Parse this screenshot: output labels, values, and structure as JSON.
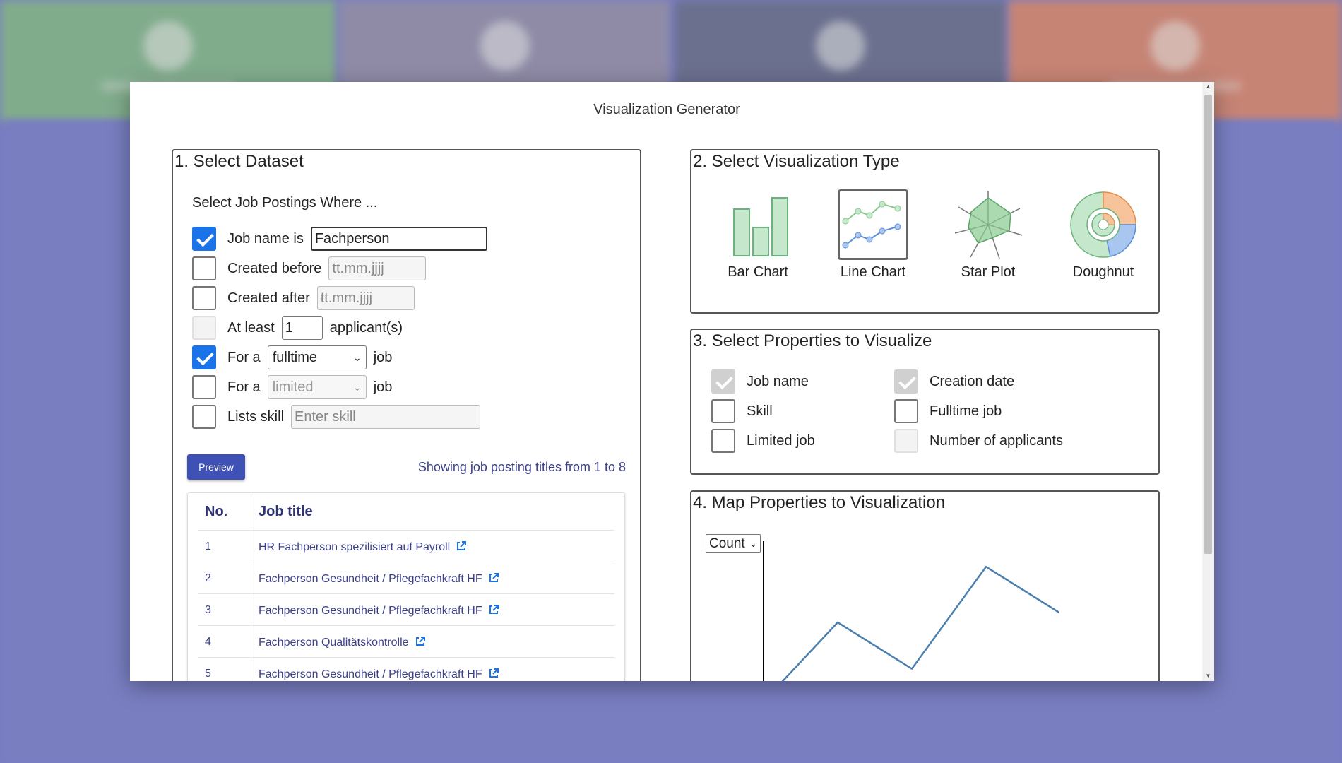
{
  "modal": {
    "title": "Visualization Generator"
  },
  "dataset": {
    "section_title": "1. Select Dataset",
    "intro": "Select Job Postings Where ...",
    "job_name": {
      "label": "Job name is",
      "value": "Fachperson",
      "checked": true
    },
    "created_before": {
      "label": "Created before",
      "placeholder": "tt.mm.jjjj",
      "checked": false
    },
    "created_after": {
      "label": "Created after",
      "placeholder": "tt.mm.jjjj",
      "checked": false
    },
    "at_least": {
      "label": "At least",
      "value": "1",
      "suffix": "applicant(s)",
      "checked": false,
      "disabled": true
    },
    "fulltime": {
      "label": "For a",
      "value": "fulltime",
      "suffix": "job",
      "checked": true
    },
    "limited": {
      "label": "For a",
      "value": "limited",
      "suffix": "job",
      "checked": false
    },
    "skill": {
      "label": "Lists skill",
      "placeholder": "Enter skill",
      "checked": false
    },
    "preview_label": "Preview",
    "showing_text": "Showing job posting titles from 1 to 8",
    "table": {
      "headers": {
        "no": "No.",
        "title": "Job title"
      },
      "rows": [
        {
          "no": "1",
          "title": "HR Fachperson spezilisiert auf Payroll"
        },
        {
          "no": "2",
          "title": "Fachperson Gesundheit / Pflegefachkraft HF"
        },
        {
          "no": "3",
          "title": "Fachperson Gesundheit / Pflegefachkraft HF"
        },
        {
          "no": "4",
          "title": "Fachperson Qualitätskontrolle"
        },
        {
          "no": "5",
          "title": "Fachperson Gesundheit / Pflegefachkraft HF"
        }
      ]
    }
  },
  "viz_type": {
    "section_title": "2. Select Visualization Type",
    "types": [
      {
        "label": "Bar Chart",
        "selected": false
      },
      {
        "label": "Line Chart",
        "selected": true
      },
      {
        "label": "Star Plot",
        "selected": false
      },
      {
        "label": "Doughnut",
        "selected": false
      }
    ]
  },
  "properties": {
    "section_title": "3. Select Properties to Visualize",
    "items": [
      {
        "label": "Job name",
        "state": "disabled-checked"
      },
      {
        "label": "Creation date",
        "state": "disabled-checked"
      },
      {
        "label": "Skill",
        "state": "unchecked"
      },
      {
        "label": "Fulltime job",
        "state": "unchecked"
      },
      {
        "label": "Limited job",
        "state": "unchecked"
      },
      {
        "label": "Number of applicants",
        "state": "disabled"
      }
    ]
  },
  "mapping": {
    "section_title": "4. Map Properties to Visualization",
    "measure": "Count",
    "preview_line": [
      2,
      8,
      3,
      14,
      9
    ]
  },
  "colors": {
    "accent": "#3f51b5",
    "checkbox": "#1a73e8",
    "bar_fill": "#c5e8cc",
    "bar_stroke": "#6cb27c",
    "line_green": "#88c98f",
    "line_blue": "#5a8fd8",
    "donut_orange": "#f5b07a",
    "preview_line": "#4a7fb0"
  }
}
